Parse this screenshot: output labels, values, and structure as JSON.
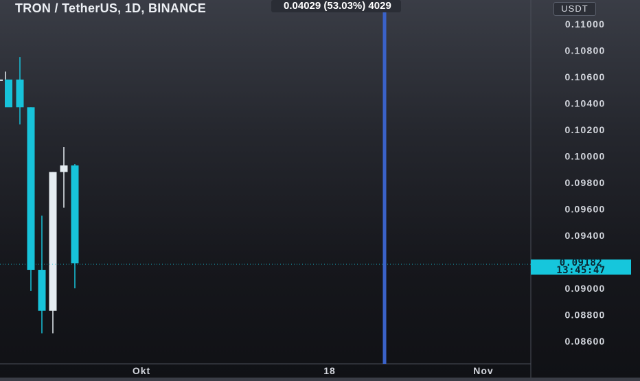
{
  "header": {
    "symbol_title": "TRON / TetherUS, 1D, BINANCE",
    "measure_tooltip": "0.04029 (53.03%) 4029"
  },
  "price_axis": {
    "currency": "USDT",
    "last_price": "0.09182",
    "countdown": "13:45:47"
  },
  "colors": {
    "up": "#e6edf2",
    "down": "#17c3da",
    "measure_line": "#3a62c8",
    "last_price_bg": "#16c6dc"
  },
  "chart_data": {
    "type": "candlestick",
    "title": "TRON / TetherUS, 1D, BINANCE",
    "ylabel": "USDT",
    "ylim": [
      0.0848,
      0.1113
    ],
    "y_ticks": [
      "0.11000",
      "0.10800",
      "0.10600",
      "0.10400",
      "0.10200",
      "0.10000",
      "0.09800",
      "0.09600",
      "0.09400",
      "0.09000",
      "0.08800",
      "0.08600"
    ],
    "x_ticks": [
      "Okt",
      "18",
      "Nov"
    ],
    "last_price": 0.09182,
    "candles": [
      {
        "o": 0.1058,
        "h": 0.1064,
        "l": 0.1058,
        "c": 0.1058,
        "dir": "up"
      },
      {
        "o": 0.1058,
        "h": 0.1075,
        "l": 0.1024,
        "c": 0.1037,
        "dir": "down"
      },
      {
        "o": 0.1037,
        "h": 0.1037,
        "l": 0.0898,
        "c": 0.0914,
        "dir": "down"
      },
      {
        "o": 0.0914,
        "h": 0.0955,
        "l": 0.0866,
        "c": 0.0883,
        "dir": "down"
      },
      {
        "o": 0.0883,
        "h": 0.0988,
        "l": 0.0866,
        "c": 0.0988,
        "dir": "up"
      },
      {
        "o": 0.0988,
        "h": 0.1007,
        "l": 0.0961,
        "c": 0.0993,
        "dir": "up"
      },
      {
        "o": 0.0993,
        "h": 0.0994,
        "l": 0.09,
        "c": 0.0919,
        "dir": "down"
      }
    ]
  }
}
